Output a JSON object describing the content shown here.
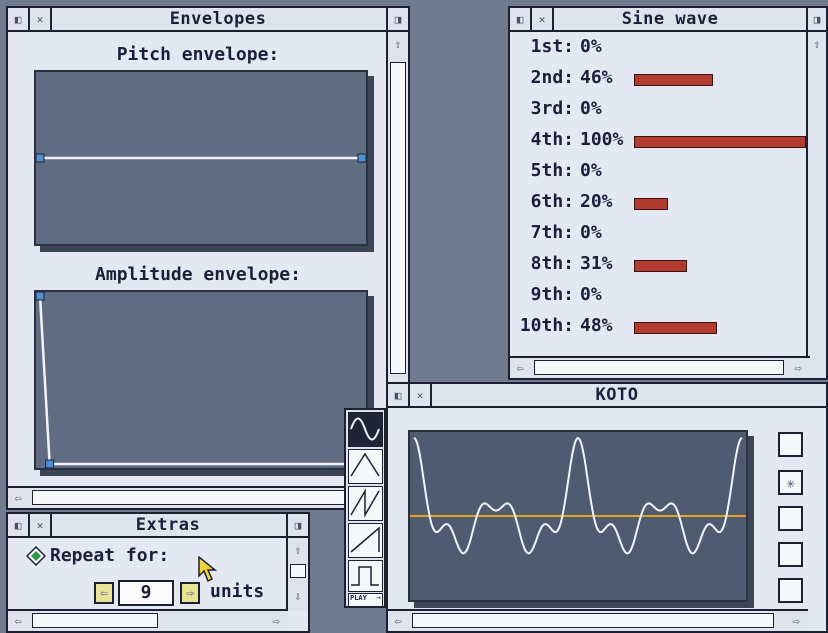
{
  "envelopes": {
    "title": "Envelopes",
    "pitch_label": "Pitch envelope:",
    "amplitude_label": "Amplitude envelope:",
    "pitch_points": [
      [
        0,
        0.5
      ],
      [
        1,
        0.5
      ]
    ],
    "amplitude_points": [
      [
        0,
        1.0
      ],
      [
        0.03,
        0.0
      ],
      [
        1,
        0.0
      ]
    ]
  },
  "sine": {
    "title": "Sine wave",
    "harmonics": [
      {
        "ord": "1st:",
        "pct": "0%",
        "value": 0
      },
      {
        "ord": "2nd:",
        "pct": "46%",
        "value": 46
      },
      {
        "ord": "3rd:",
        "pct": "0%",
        "value": 0
      },
      {
        "ord": "4th:",
        "pct": "100%",
        "value": 100
      },
      {
        "ord": "5th:",
        "pct": "0%",
        "value": 0
      },
      {
        "ord": "6th:",
        "pct": "20%",
        "value": 20
      },
      {
        "ord": "7th:",
        "pct": "0%",
        "value": 0
      },
      {
        "ord": "8th:",
        "pct": "31%",
        "value": 31
      },
      {
        "ord": "9th:",
        "pct": "0%",
        "value": 0
      },
      {
        "ord": "10th:",
        "pct": "48%",
        "value": 48
      }
    ]
  },
  "koto": {
    "title": "KOTO"
  },
  "extras": {
    "title": "Extras",
    "repeat_label": "Repeat for:",
    "repeat_value": "9",
    "units_label": "units"
  },
  "tools": {
    "play_label": "PLAY"
  },
  "colors": {
    "window_bg": "#e4e8f3",
    "panel": "#5f6c82",
    "bar": "#b23b30",
    "wave": "#f2f3fa",
    "axis": "#e8a21b",
    "handle": "#4f8fd6"
  }
}
